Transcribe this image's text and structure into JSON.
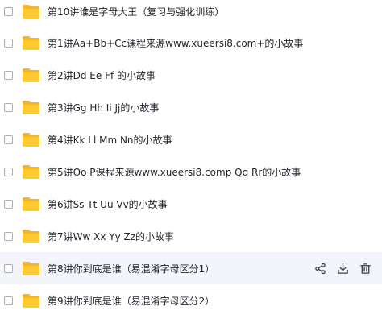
{
  "files": [
    {
      "name": "第10讲谁是字母大王（复习与强化训练）"
    },
    {
      "name": "第1讲Aa+Bb+Cc课程来源www.xueersi8.com+的小故事"
    },
    {
      "name": "第2讲Dd Ee Ff 的小故事"
    },
    {
      "name": "第3讲Gg Hh Ii Jj的小故事"
    },
    {
      "name": "第4讲Kk Ll Mm Nn的小故事"
    },
    {
      "name": "第5讲Oo P课程来源www.xueersi8.comp Qq Rr的小故事"
    },
    {
      "name": "第6讲Ss Tt Uu Vv的小故事"
    },
    {
      "name": "第7讲Ww Xx Yy Zz的小故事"
    },
    {
      "name": "第8讲你到底是谁（易混淆字母区分1）"
    },
    {
      "name": "第9讲你到底是谁（易混淆字母区分2）"
    }
  ],
  "hovered_row_index": 8,
  "row_actions": [
    "share-icon",
    "download-icon",
    "delete-icon"
  ],
  "colors": {
    "folder": "#ffc933",
    "folder_back": "#f7b52b",
    "hover_bg": "#f3f5fa",
    "text": "#1f2329",
    "icon": "#3b3f46"
  }
}
